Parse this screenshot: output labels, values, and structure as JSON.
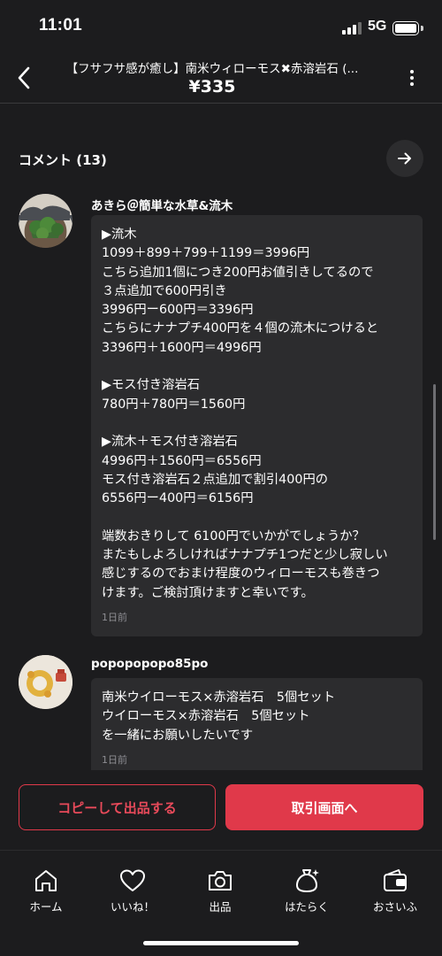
{
  "status_bar": {
    "time": "11:01",
    "network": "5G"
  },
  "header": {
    "title": "【フサフサ感が癒し】南米ウィローモス✖︎赤溶岩石 (...",
    "price": "¥335",
    "back_icon": "chevron-left-icon",
    "more_icon": "more-vertical-icon"
  },
  "comments": {
    "title": "コメント (13)",
    "items": [
      {
        "author": "あきら＠簡単な水草&流木",
        "lines": [
          "▶︎流木",
          "1099＋899＋799＋1199＝3996円",
          "こちら追加1個につき200円お値引きしてるので",
          "３点追加で600円引き",
          "3996円ー600円＝3396円",
          "こちらにナナプチ400円を４個の流木につけると",
          "3396円＋1600円＝4996円",
          "",
          "▶︎モス付き溶岩石",
          "780円＋780円＝1560円",
          "",
          "▶︎流木＋モス付き溶岩石",
          "4996円＋1560円＝6556円",
          "モス付き溶岩石２点追加で割引400円の",
          "6556円ー400円＝6156円",
          "",
          "端数おきりして 6100円でいかがでしょうか？",
          "またもしよろしければナナプチ1つだと少し寂しい",
          "感じするのでおまけ程度のウィローモスも巻きつ",
          "けます。ご検討頂けますと幸いです。"
        ],
        "time": "1日前"
      },
      {
        "author": "popopopopo85po",
        "lines": [
          "南米ウイローモス×赤溶岩石　5個セット",
          "ウイローモス×赤溶岩石　5個セット",
          "を一緒にお願いしたいです"
        ],
        "time": "1日前"
      }
    ]
  },
  "actions": {
    "copy_label": "コピーして出品する",
    "trade_label": "取引画面へ"
  },
  "tabbar": {
    "items": [
      {
        "label": "ホーム",
        "icon": "home-icon"
      },
      {
        "label": "いいね！",
        "icon": "heart-icon"
      },
      {
        "label": "出品",
        "icon": "camera-icon"
      },
      {
        "label": "はたらく",
        "icon": "money-bag-icon"
      },
      {
        "label": "おさいふ",
        "icon": "wallet-icon"
      }
    ]
  },
  "colors": {
    "background": "#1c1c1e",
    "bubble": "#2c2c2e",
    "accent": "#e0394a",
    "muted": "#8e8e93"
  }
}
